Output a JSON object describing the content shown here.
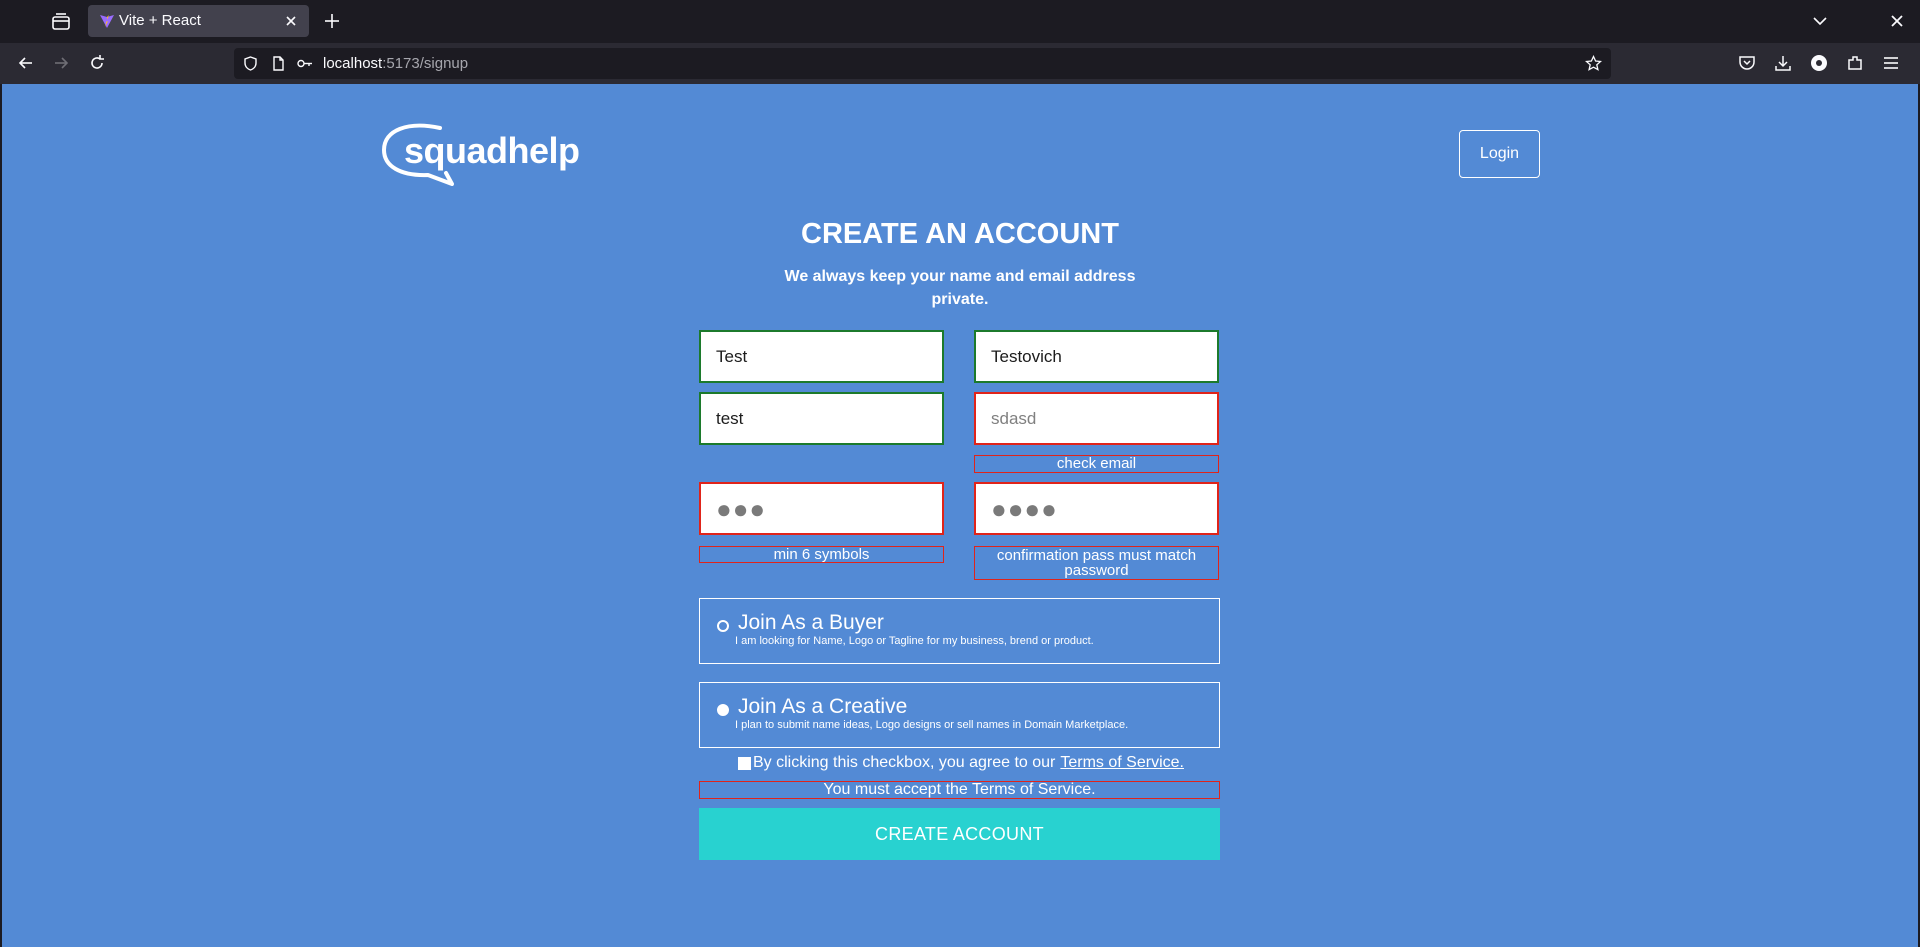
{
  "browser": {
    "tab_title": "Vite + React",
    "url_host": "localhost",
    "url_path": ":5173/signup"
  },
  "header": {
    "logo_text": "squadhelp",
    "login_label": "Login"
  },
  "form": {
    "title": "CREATE AN ACCOUNT",
    "subtitle": "We always keep your name and email address private.",
    "first_name": "Test",
    "last_name": "Testovich",
    "display_name": "test",
    "email_placeholder": "sdasd",
    "email_error": "check email",
    "password_masked": "●●●",
    "password_error": "min 6 symbols",
    "confirm_masked": "●●●●",
    "confirm_error": "confirmation pass must match password",
    "buyer_title": "Join As a Buyer",
    "buyer_desc": "I am looking for Name, Logo or Tagline for my business, brend or product.",
    "creative_title": "Join As a Creative",
    "creative_desc": "I plan to submit name ideas, Logo designs or sell names in Domain Marketplace.",
    "terms_text": "By clicking this checkbox, you agree to our",
    "terms_link": "Terms of Service.",
    "terms_error": "You must accept the Terms of Service.",
    "submit_label": "CREATE ACCOUNT"
  },
  "colors": {
    "page_bg": "#538ad5",
    "valid_border": "#1c7a2c",
    "error_border": "#e0241a",
    "submit_bg": "#28d2d0"
  }
}
